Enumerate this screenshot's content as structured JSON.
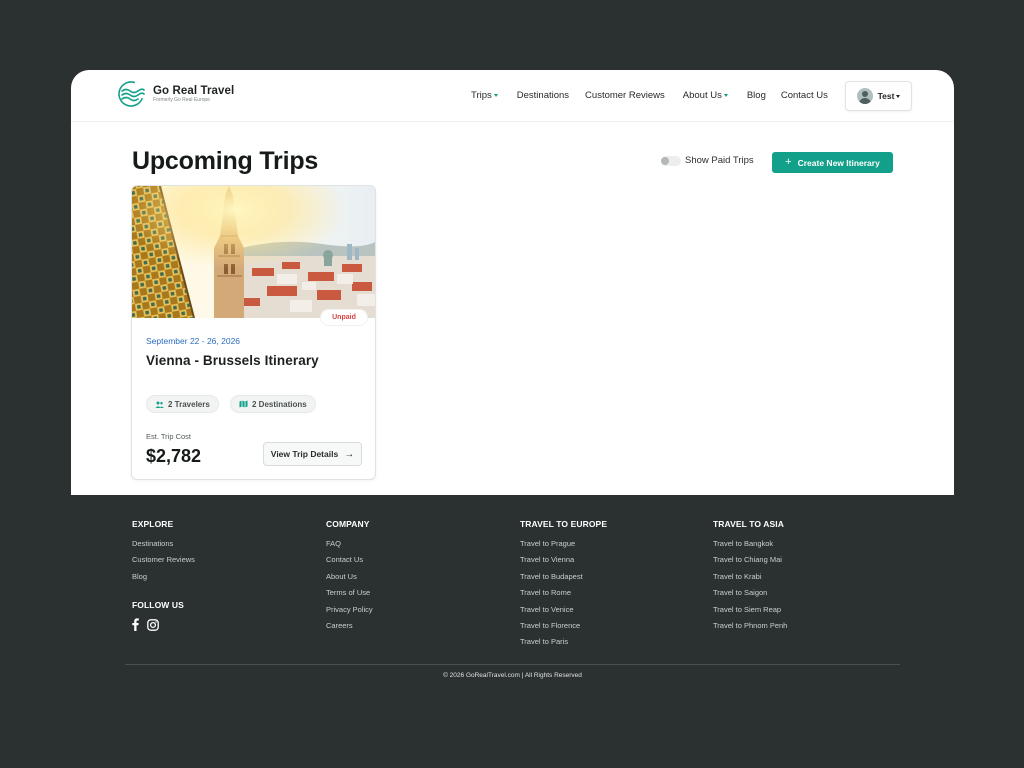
{
  "brand": {
    "name": "Go Real Travel",
    "tagline": "Formerly Go Real Europe",
    "accent_color": "#12a08a"
  },
  "nav": {
    "items": [
      {
        "label": "Trips",
        "has_dropdown": true
      },
      {
        "label": "Destinations",
        "has_dropdown": false
      },
      {
        "label": "Customer Reviews",
        "has_dropdown": false
      },
      {
        "label": "About Us",
        "has_dropdown": true
      },
      {
        "label": "Blog",
        "has_dropdown": false
      },
      {
        "label": "Contact Us",
        "has_dropdown": false
      }
    ],
    "user": {
      "name": "Test",
      "icon": "user-avatar-icon"
    }
  },
  "main": {
    "title": "Upcoming Trips",
    "toggle_label": "Show Paid Trips",
    "toggle_on": false,
    "create_button": "Create New Itinerary"
  },
  "trip": {
    "status": "Unpaid",
    "status_color": "#d94545",
    "dates": "September 22 - 26, 2026",
    "title": "Vienna - Brussels Itinerary",
    "travelers": "2 Travelers",
    "destinations": "2 Destinations",
    "cost_label": "Est. Trip Cost",
    "cost": "$2,782",
    "details_button": "View Trip Details",
    "image_icon": "city-photo"
  },
  "footer": {
    "explore": {
      "heading": "EXPLORE",
      "links": [
        "Destinations",
        "Customer Reviews",
        "Blog"
      ]
    },
    "follow": {
      "heading": "FOLLOW US",
      "icons": [
        "facebook-icon",
        "instagram-icon"
      ]
    },
    "company": {
      "heading": "COMPANY",
      "links": [
        "FAQ",
        "Contact Us",
        "About Us",
        "Terms of Use",
        "Privacy Policy",
        "Careers"
      ]
    },
    "europe": {
      "heading": "TRAVEL TO EUROPE",
      "links": [
        "Travel to Prague",
        "Travel to Vienna",
        "Travel to Budapest",
        "Travel to Rome",
        "Travel to Venice",
        "Travel to Florence",
        "Travel to Paris"
      ]
    },
    "asia": {
      "heading": "TRAVEL TO ASIA",
      "links": [
        "Travel to Bangkok",
        "Travel to Chiang Mai",
        "Travel to Krabi",
        "Travel to Saigon",
        "Travel to Siem Reap",
        "Travel to Phnom Penh"
      ]
    },
    "copyright": "© 2026 GoRealTravel.com | All Rights Reserved"
  }
}
